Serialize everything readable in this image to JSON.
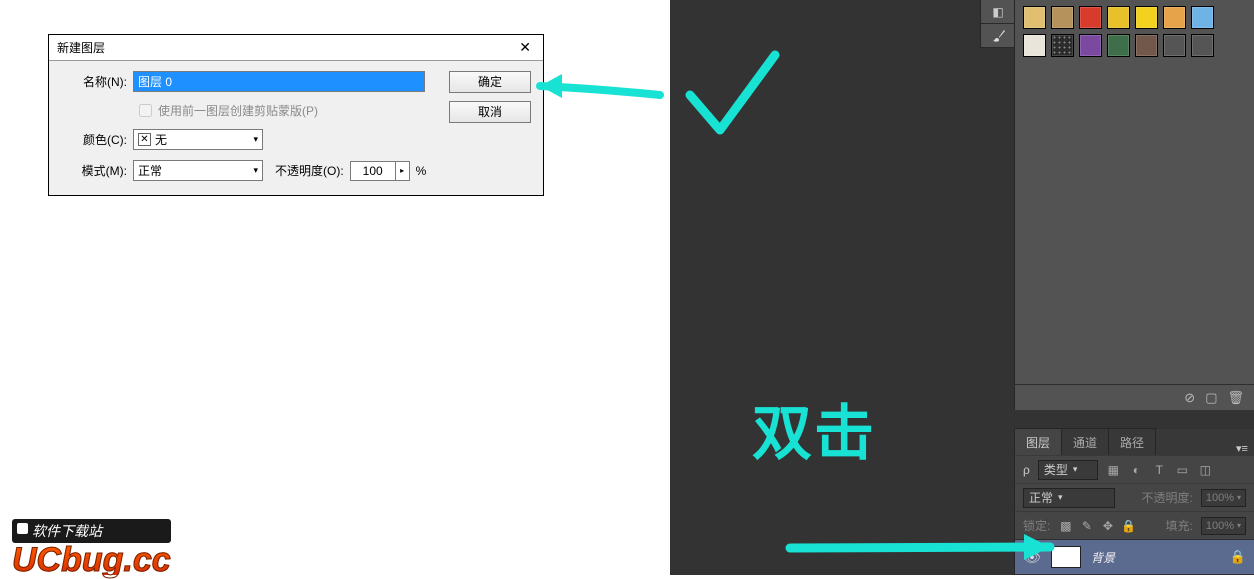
{
  "dialog": {
    "title": "新建图层",
    "name_label": "名称(N):",
    "name_value": "图层 0",
    "clip_label": "使用前一图层创建剪贴蒙版(P)",
    "color_label": "颜色(C):",
    "color_value": "无",
    "mode_label": "模式(M):",
    "mode_value": "正常",
    "opacity_label": "不透明度(O):",
    "opacity_value": "100",
    "opacity_unit": "%",
    "ok": "确定",
    "cancel": "取消"
  },
  "logo": {
    "top": "软件下载站",
    "bottom": "UCbug.cc"
  },
  "swatches": {
    "row1": [
      "#e0c070",
      "#b5925b",
      "#d73b2b",
      "#e8c02a",
      "#f2d21e",
      "#e7a34a",
      "#6db3e6"
    ],
    "row2": [
      "#e9e5da",
      "#3a3a3a",
      "#7b4aa0",
      "#3f6f4a",
      "#72584a",
      "#555555",
      "#555555"
    ]
  },
  "layers_panel": {
    "tabs": {
      "layers": "图层",
      "channels": "通道",
      "paths": "路径"
    },
    "kind_label": "类型",
    "mode": "正常",
    "opacity_label": "不透明度:",
    "opacity_value": "100%",
    "lock_label": "锁定:",
    "fill_label": "填充:",
    "fill_value": "100%",
    "layer_name": "背景"
  },
  "annotations": {
    "double_click": "双击"
  }
}
